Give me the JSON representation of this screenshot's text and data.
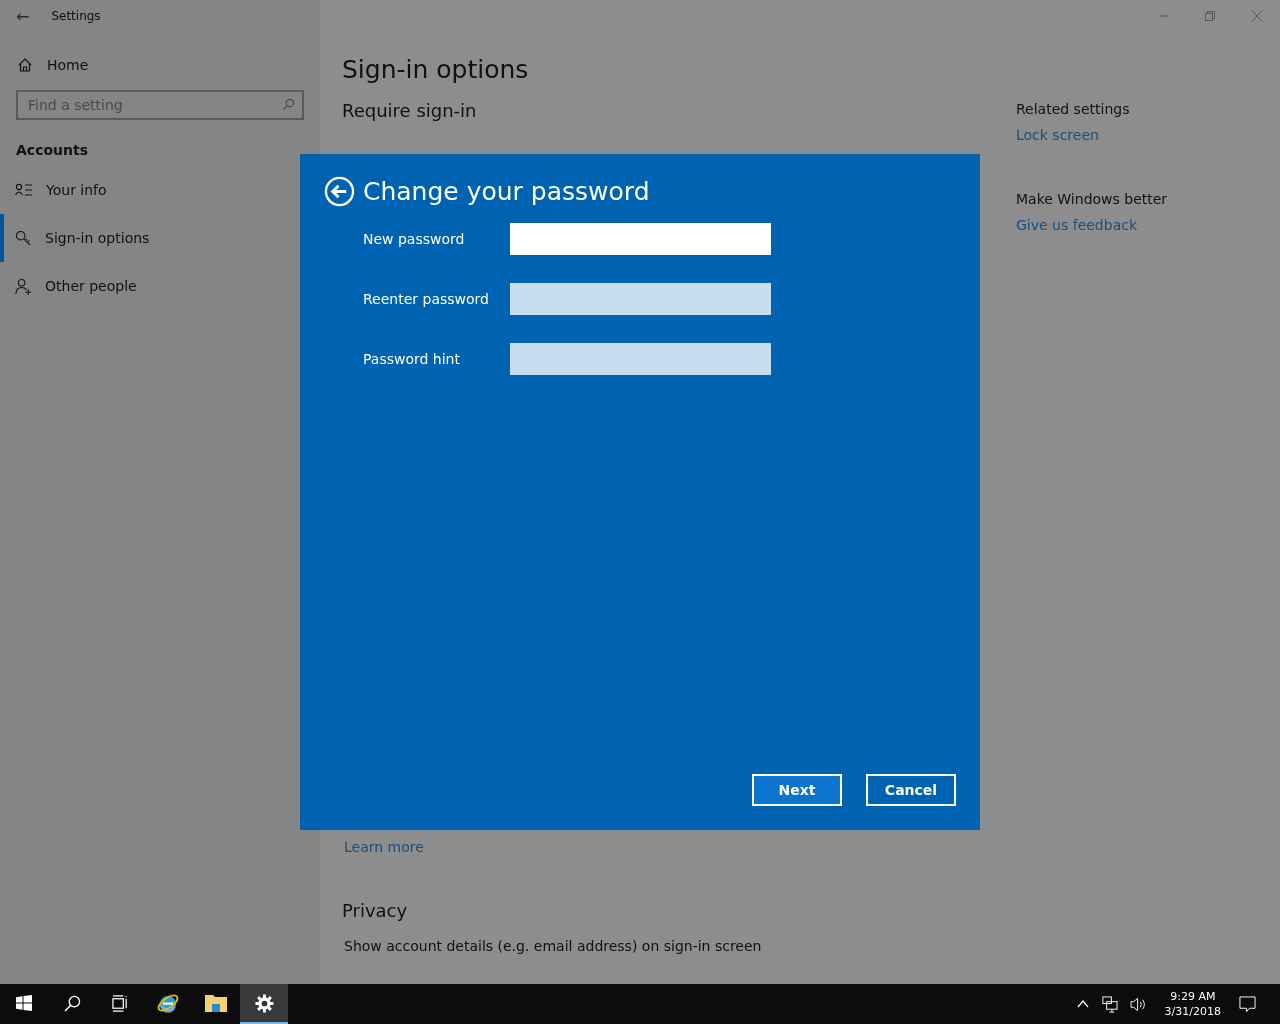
{
  "window": {
    "title": "Settings",
    "back_glyph": "←"
  },
  "sidebar": {
    "home": "Home",
    "search": {
      "placeholder": "Find a setting"
    },
    "section": "Accounts",
    "items": [
      {
        "label": "Your info",
        "kind": "info",
        "selected": false
      },
      {
        "label": "Sign-in options",
        "kind": "key",
        "selected": true
      },
      {
        "label": "Other people",
        "kind": "people",
        "selected": false
      }
    ]
  },
  "main": {
    "title": "Sign-in options",
    "subtitle": "Require sign-in",
    "learn_more": "Learn more",
    "privacy_heading": "Privacy",
    "privacy_text": "Show account details (e.g. email address) on sign-in screen"
  },
  "related": [
    {
      "heading": "Related settings",
      "link": "Lock screen"
    },
    {
      "heading": "Make Windows better",
      "link": "Give us feedback"
    }
  ],
  "dialog": {
    "title": "Change your password",
    "fields": [
      {
        "label": "New password",
        "focused": true
      },
      {
        "label": "Reenter password",
        "focused": false
      },
      {
        "label": "Password hint",
        "focused": false
      }
    ],
    "buttons": [
      {
        "label": "Next",
        "primary": true
      },
      {
        "label": "Cancel",
        "primary": false
      }
    ]
  },
  "taskbar": {
    "apps": [
      {
        "kind": "start",
        "active": false
      },
      {
        "kind": "search",
        "active": false
      },
      {
        "kind": "taskview",
        "active": false
      },
      {
        "kind": "ie",
        "active": false
      },
      {
        "kind": "folder",
        "active": false
      },
      {
        "kind": "settings",
        "active": true
      }
    ],
    "time": "9:29 AM",
    "date": "3/31/2018"
  }
}
